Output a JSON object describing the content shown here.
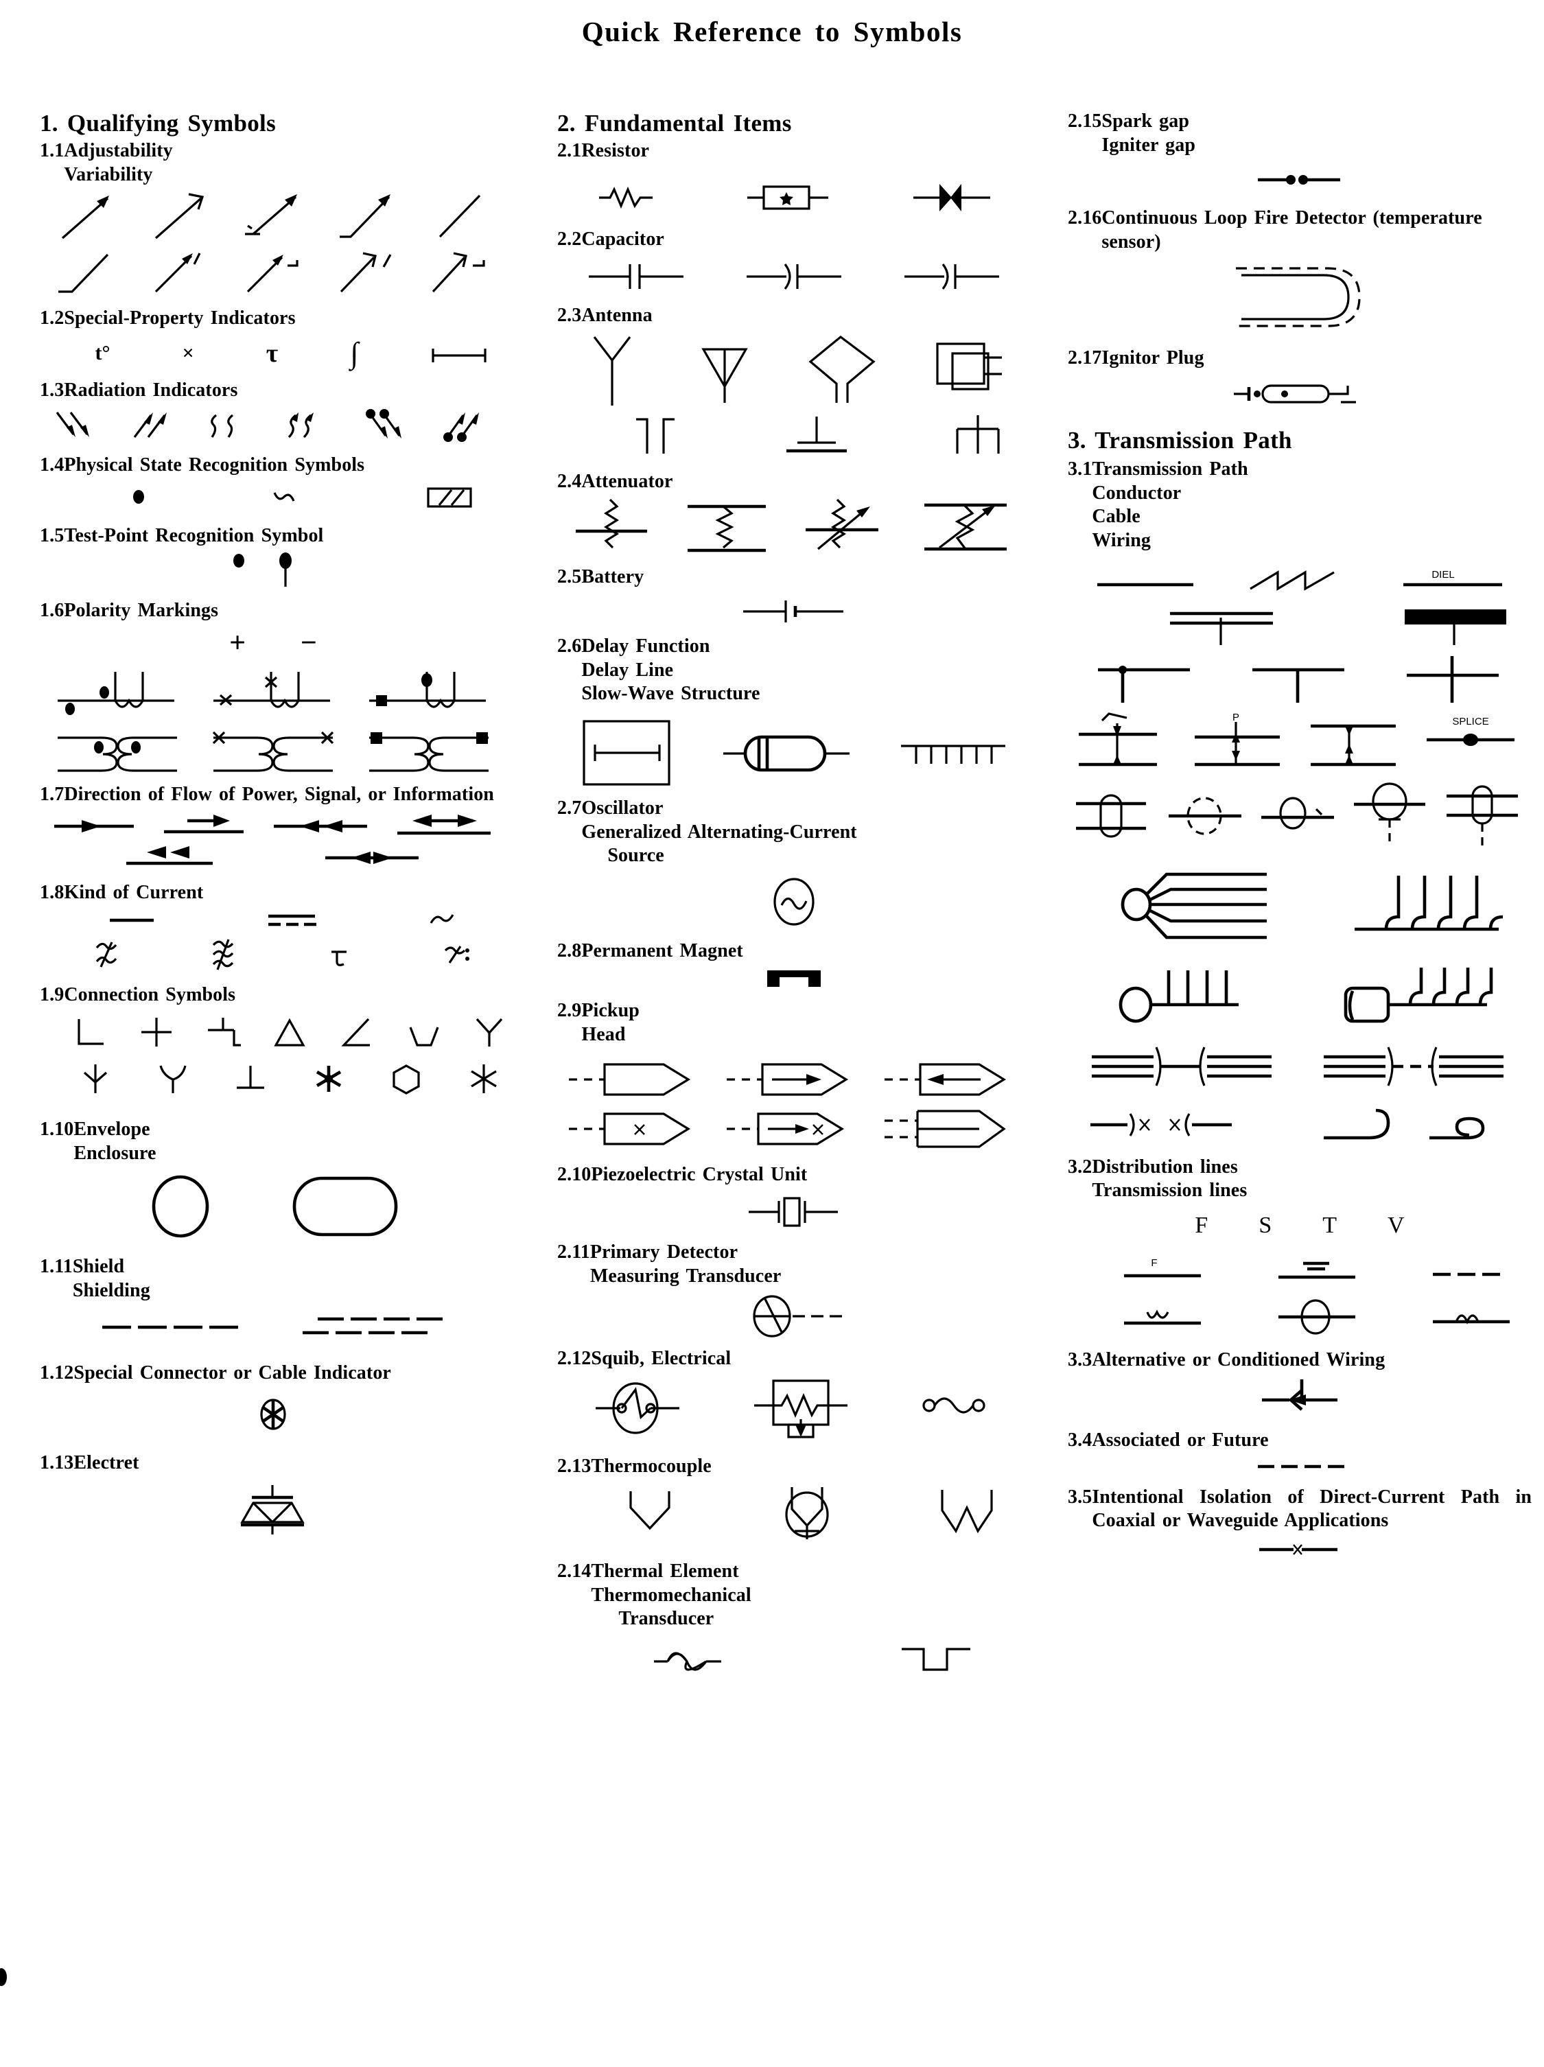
{
  "title": "Quick  Reference  to  Symbols",
  "columns": [
    {
      "id": "col1",
      "section": {
        "num": "1.",
        "name": "Qualifying Symbols"
      },
      "items": [
        {
          "num": "1.1",
          "lines": [
            "Adjustability",
            "Variability"
          ],
          "symbol_count": 10,
          "symbol_note": "adjustability arrows: two rows of five inclined arrows"
        },
        {
          "num": "1.2",
          "lines": [
            "Special-Property Indicators"
          ],
          "symbol_count": 5,
          "glyphs": [
            "t°",
            "×",
            "τ",
            "∫",
            "—"
          ]
        },
        {
          "num": "1.3",
          "lines": [
            "Radiation Indicators"
          ],
          "symbol_count": 6
        },
        {
          "num": "1.4",
          "lines": [
            "Physical State Recognition Symbols"
          ],
          "symbol_count": 3
        },
        {
          "num": "1.5",
          "lines": [
            "Test-Point Recognition Symbol"
          ],
          "symbol_count": 2
        },
        {
          "num": "1.6",
          "lines": [
            "Polarity Markings"
          ],
          "symbol_count": 8,
          "glyphs": [
            "+",
            "−"
          ]
        },
        {
          "num": "1.7",
          "lines": [
            "Direction of Flow of Power, Signal, or Information"
          ],
          "flow": true,
          "symbol_count": 6
        },
        {
          "num": "1.8",
          "lines": [
            "Kind of Current"
          ],
          "symbol_count": 7
        },
        {
          "num": "1.9",
          "lines": [
            "Connection Symbols"
          ],
          "symbol_count": 14
        },
        {
          "num": "1.10",
          "lines": [
            "Envelope",
            "Enclosure"
          ],
          "symbol_count": 2
        },
        {
          "num": "1.11",
          "lines": [
            "Shield",
            "Shielding"
          ],
          "symbol_count": 2
        },
        {
          "num": "1.12",
          "lines": [
            "Special Connector or Cable Indicator"
          ],
          "flow": true,
          "symbol_count": 1
        },
        {
          "num": "1.13",
          "lines": [
            "Electret"
          ],
          "symbol_count": 1
        }
      ]
    },
    {
      "id": "col2",
      "section": {
        "num": "2.",
        "name": "Fundamental Items"
      },
      "items": [
        {
          "num": "2.1",
          "lines": [
            "Resistor"
          ],
          "symbol_count": 3
        },
        {
          "num": "2.2",
          "lines": [
            "Capacitor"
          ],
          "symbol_count": 3
        },
        {
          "num": "2.3",
          "lines": [
            "Antenna"
          ],
          "symbol_count": 7
        },
        {
          "num": "2.4",
          "lines": [
            "Attenuator"
          ],
          "symbol_count": 4
        },
        {
          "num": "2.5",
          "lines": [
            "Battery"
          ],
          "symbol_count": 1
        },
        {
          "num": "2.6",
          "lines": [
            "Delay Function",
            "Delay Line",
            "Slow-Wave Structure"
          ],
          "symbol_count": 3
        },
        {
          "num": "2.7",
          "lines": [
            "Oscillator",
            "Generalized Alternating-Current",
            "Source"
          ],
          "symbol_count": 1
        },
        {
          "num": "2.8",
          "lines": [
            "Permanent Magnet"
          ],
          "symbol_count": 1
        },
        {
          "num": "2.9",
          "lines": [
            "Pickup",
            "Head"
          ],
          "symbol_count": 6
        },
        {
          "num": "2.10",
          "lines": [
            "Piezoelectric Crystal Unit"
          ],
          "symbol_count": 1
        },
        {
          "num": "2.11",
          "lines": [
            "Primary Detector",
            "Measuring Transducer"
          ],
          "symbol_count": 1
        },
        {
          "num": "2.12",
          "lines": [
            "Squib, Electrical"
          ],
          "symbol_count": 3
        },
        {
          "num": "2.13",
          "lines": [
            "Thermocouple"
          ],
          "symbol_count": 3
        },
        {
          "num": "2.14",
          "lines": [
            "Thermal Element",
            "Thermomechanical",
            "Transducer"
          ],
          "symbol_count": 2
        }
      ]
    },
    {
      "id": "col3",
      "section": {
        "num": "3.",
        "name": "Transmission Path"
      },
      "items_before": [
        {
          "num": "2.15",
          "lines": [
            "Spark gap",
            "Igniter gap"
          ],
          "symbol_count": 1
        },
        {
          "num": "2.16",
          "lines": [
            "Continuous Loop Fire Detector (temperature sensor)"
          ],
          "flow": true,
          "symbol_count": 1
        },
        {
          "num": "2.17",
          "lines": [
            "Ignitor Plug"
          ],
          "symbol_count": 1
        }
      ],
      "items": [
        {
          "num": "3.1",
          "lines": [
            "Transmission Path",
            "Conductor",
            "Cable",
            "Wiring"
          ],
          "symbol_count": 25,
          "labels": [
            "DIEL",
            "P",
            "SPLICE"
          ]
        },
        {
          "num": "3.2",
          "lines": [
            "Distribution lines",
            "Transmission lines"
          ],
          "symbol_count": 6,
          "headers": [
            "F",
            "S",
            "T",
            "V"
          ],
          "labels": [
            "F"
          ]
        },
        {
          "num": "3.3",
          "lines": [
            "Alternative or Conditioned Wiring"
          ],
          "symbol_count": 1
        },
        {
          "num": "3.4",
          "lines": [
            "Associated or Future"
          ],
          "symbol_count": 1
        },
        {
          "num": "3.5",
          "lines": [
            "Intentional Isolation of Direct-Current Path in Coaxial or Waveguide Applications"
          ],
          "flow": true,
          "symbol_count": 1
        }
      ]
    }
  ]
}
